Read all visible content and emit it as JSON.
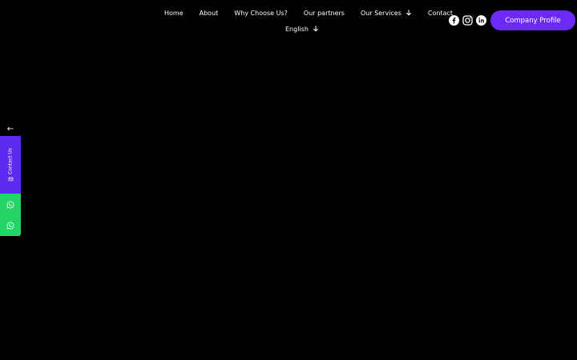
{
  "nav": {
    "items": [
      {
        "label": "Home"
      },
      {
        "label": "About"
      },
      {
        "label": "Why Choose Us?"
      },
      {
        "label": "Our partners"
      },
      {
        "label": "Our Services",
        "has_dropdown": true
      },
      {
        "label": "Contact"
      }
    ],
    "language": {
      "label": "English",
      "has_dropdown": true
    }
  },
  "socials": [
    {
      "icon": "facebook-icon"
    },
    {
      "icon": "instagram-icon"
    },
    {
      "icon": "linkedin-icon"
    }
  ],
  "profile_button": {
    "label": "Company Profile"
  },
  "side_panel": {
    "toggle_glyph": "←",
    "contact_label": "Contact Us",
    "contact_icon": "mail-icon",
    "whatsapp_icons": [
      "whatsapp-icon",
      "whatsapp-icon"
    ]
  },
  "colors": {
    "background": "#000000",
    "accent": "#6b2af5",
    "contact_tab": "#5b2cf0",
    "whatsapp": "#25d366",
    "text": "#ffffff"
  }
}
